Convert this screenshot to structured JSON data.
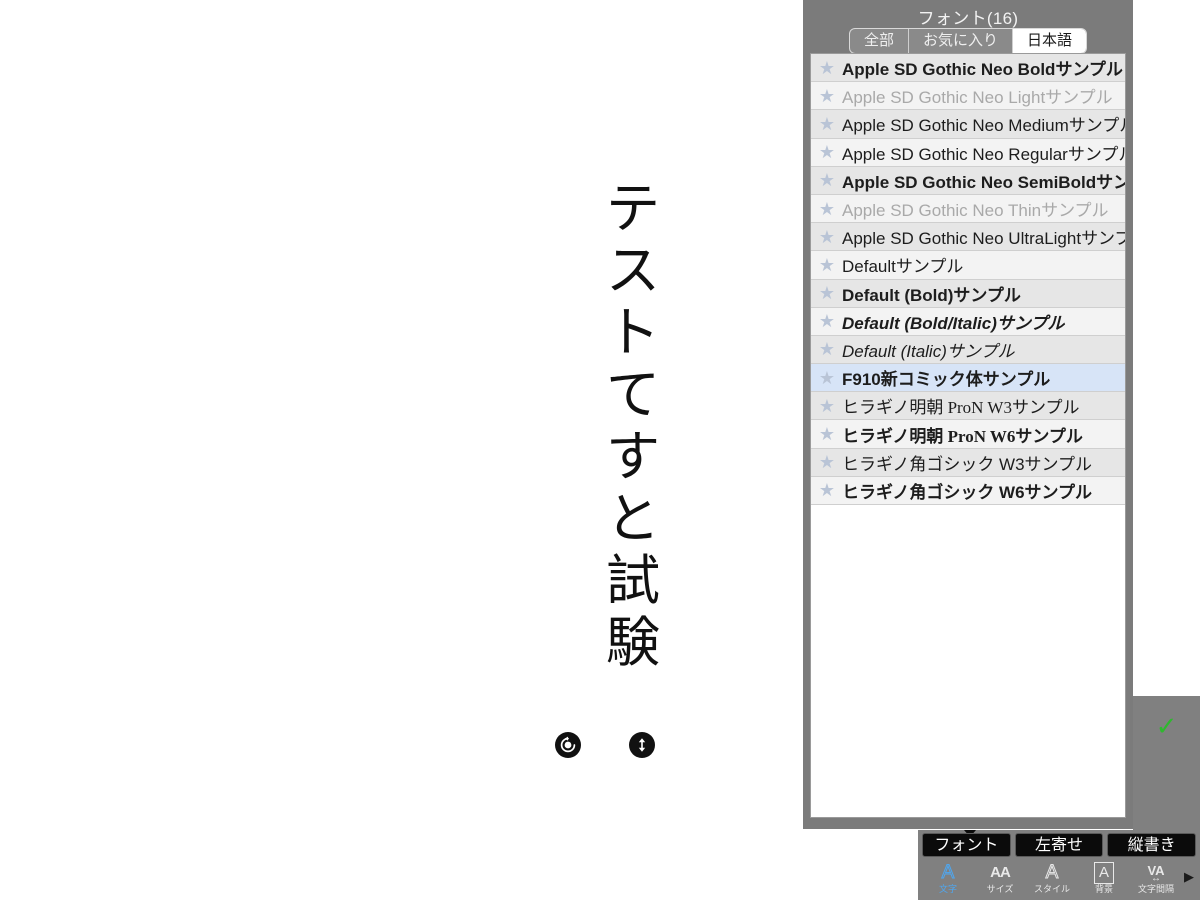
{
  "canvas": {
    "text_vertical": "テストてすと試験",
    "rotate_handle": "rotate-handle",
    "resize_handle": "resize-handle"
  },
  "font_panel": {
    "title": "フォント(16)",
    "tabs": [
      {
        "label": "全部",
        "active": false
      },
      {
        "label": "お気に入り",
        "active": false
      },
      {
        "label": "日本語",
        "active": true
      }
    ],
    "star_glyph": "★",
    "rows": [
      {
        "label": "Apple SD Gothic Neo Boldサンプル",
        "weight": "bold",
        "style": "normal",
        "family": "sans",
        "dim": false,
        "selected": false
      },
      {
        "label": "Apple SD Gothic Neo Lightサンプル",
        "weight": "normal",
        "style": "normal",
        "family": "sans",
        "dim": true,
        "selected": false
      },
      {
        "label": "Apple SD Gothic Neo Mediumサンプル",
        "weight": "normal",
        "style": "normal",
        "family": "sans",
        "dim": false,
        "selected": false
      },
      {
        "label": "Apple SD Gothic Neo Regularサンプル",
        "weight": "normal",
        "style": "normal",
        "family": "sans",
        "dim": false,
        "selected": false
      },
      {
        "label": "Apple SD Gothic Neo SemiBoldサンプル",
        "weight": "bold",
        "style": "normal",
        "family": "sans",
        "dim": false,
        "selected": false
      },
      {
        "label": "Apple SD Gothic Neo Thinサンプル",
        "weight": "normal",
        "style": "normal",
        "family": "sans",
        "dim": true,
        "selected": false
      },
      {
        "label": "Apple SD Gothic Neo UltraLightサンプル",
        "weight": "normal",
        "style": "normal",
        "family": "sans",
        "dim": false,
        "selected": false
      },
      {
        "label": "Defaultサンプル",
        "weight": "normal",
        "style": "normal",
        "family": "sans",
        "dim": false,
        "selected": false
      },
      {
        "label": "Default (Bold)サンプル",
        "weight": "bold",
        "style": "normal",
        "family": "sans",
        "dim": false,
        "selected": false
      },
      {
        "label": "Default (Bold/Italic)サンプル",
        "weight": "bold",
        "style": "italic",
        "family": "sans",
        "dim": false,
        "selected": false
      },
      {
        "label": "Default (Italic)サンプル",
        "weight": "normal",
        "style": "italic",
        "family": "sans",
        "dim": false,
        "selected": false
      },
      {
        "label": "F910新コミック体サンプル",
        "weight": "bold",
        "style": "normal",
        "family": "sans",
        "dim": false,
        "selected": true
      },
      {
        "label": "ヒラギノ明朝 ProN W3サンプル",
        "weight": "normal",
        "style": "normal",
        "family": "serif",
        "dim": false,
        "selected": false
      },
      {
        "label": "ヒラギノ明朝 ProN W6サンプル",
        "weight": "bold",
        "style": "normal",
        "family": "serif",
        "dim": false,
        "selected": false
      },
      {
        "label": "ヒラギノ角ゴシック W3サンプル",
        "weight": "normal",
        "style": "normal",
        "family": "sans",
        "dim": false,
        "selected": false
      },
      {
        "label": "ヒラギノ角ゴシック W6サンプル",
        "weight": "bold",
        "style": "normal",
        "family": "sans",
        "dim": false,
        "selected": false
      }
    ]
  },
  "toolbar": {
    "confirm_glyph": "✓",
    "confirm_color": "#2eb82e",
    "buttons": [
      {
        "label": "フォント"
      },
      {
        "label": "左寄せ"
      },
      {
        "label": "縦書き"
      }
    ],
    "icons": [
      {
        "glyph": "A",
        "caption": "文字",
        "active": true,
        "kind": "plain"
      },
      {
        "glyph": "AA",
        "caption": "サイズ",
        "active": false,
        "kind": "aa"
      },
      {
        "glyph": "A",
        "caption": "スタイル",
        "active": false,
        "kind": "outline"
      },
      {
        "glyph": "A",
        "caption": "背景",
        "active": false,
        "kind": "boxed"
      },
      {
        "glyph": "VA",
        "caption": "文字間隔",
        "active": false,
        "kind": "va"
      }
    ],
    "more_arrow": "▶"
  },
  "colors": {
    "panel_bg": "#7b7b7b",
    "toolbar_bg": "#808080",
    "selected_row": "#d7e4f7",
    "row_a": "#e6e6e6",
    "row_b": "#f3f3f3",
    "accent": "#4ea7f0"
  }
}
